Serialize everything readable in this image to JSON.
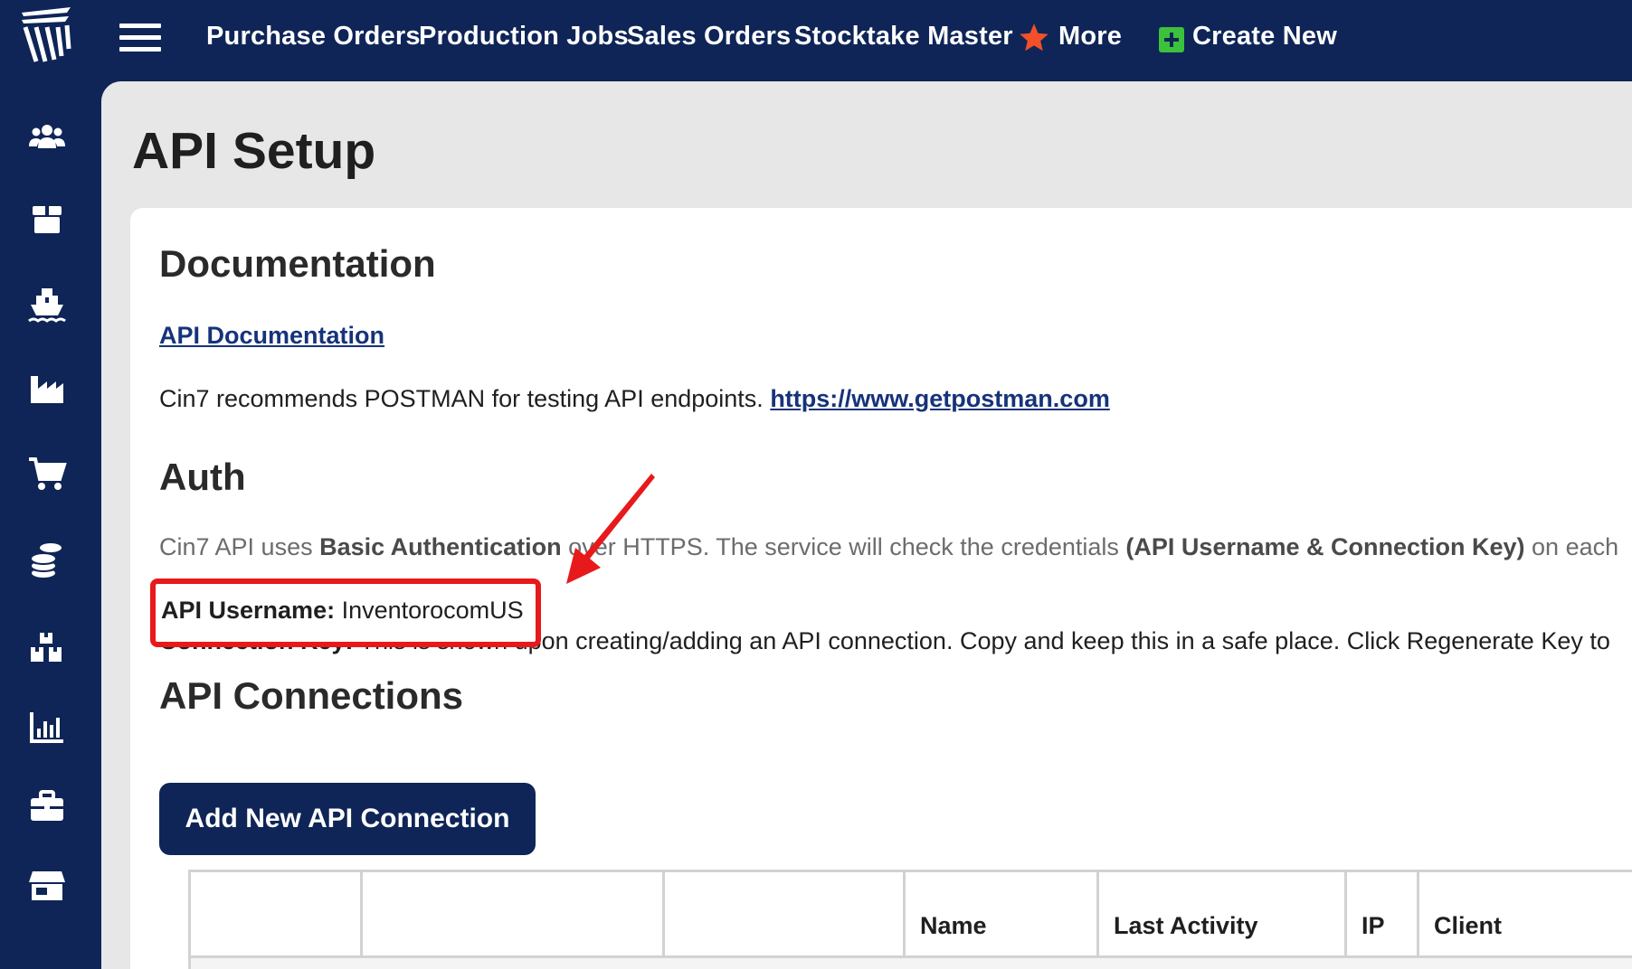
{
  "topbar": {
    "nav": [
      {
        "label": "Purchase Orders"
      },
      {
        "label": "Production Jobs"
      },
      {
        "label": "Sales Orders"
      },
      {
        "label": "Stocktake Master"
      },
      {
        "label": "More"
      },
      {
        "label": "Create New"
      }
    ]
  },
  "sidebar": {
    "icons": [
      "users-icon",
      "package-icon",
      "ship-icon",
      "factory-icon",
      "cart-icon",
      "coins-icon",
      "warehouse-icon",
      "bar-chart-icon",
      "briefcase-icon",
      "store-icon"
    ]
  },
  "page": {
    "title": "API Setup"
  },
  "documentation": {
    "heading": "Documentation",
    "api_doc_link": "API Documentation",
    "postman_text": "Cin7 recommends POSTMAN for testing API endpoints.",
    "postman_link": "https://www.getpostman.com"
  },
  "auth": {
    "heading": "Auth",
    "intro_prefix": "Cin7 API uses",
    "intro_bold1": "Basic Authentication",
    "intro_mid": "over HTTPS. The service will check the credentials",
    "intro_bold2": "(API Username & Connection Key)",
    "intro_suffix": "on each",
    "username_label": "API Username:",
    "username_value": "InventorocomUS",
    "key_label": "Connection Key:",
    "key_text": "This is shown upon creating/adding an API connection. Copy and keep this in a safe place. Click Regenerate Key to"
  },
  "connections": {
    "heading": "API Connections",
    "add_button": "Add New API Connection",
    "columns": [
      "",
      "",
      "",
      "Name",
      "Last Activity",
      "IP",
      "Client"
    ]
  },
  "colors": {
    "navy": "#0f2557",
    "highlight_red": "#e8191b",
    "star_orange": "#f2502a",
    "plus_green": "#3cc13c"
  }
}
